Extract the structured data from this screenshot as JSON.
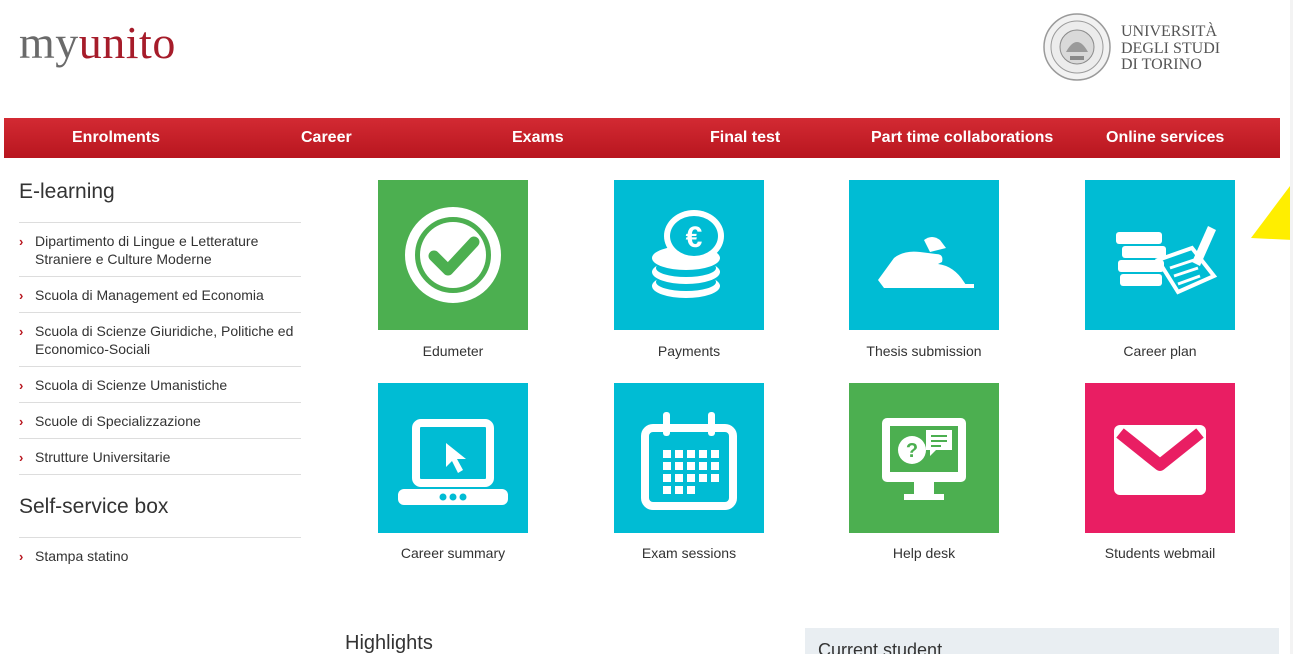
{
  "header": {
    "logo_part1": "my",
    "logo_part2": "unito",
    "university_line1": "UNIVERSITÀ",
    "university_line2": "DEGLI STUDI",
    "university_line3": "DI TORINO",
    "seal_icon": "university-seal-icon",
    "brand_color": "#b8161f"
  },
  "nav": [
    "Enrolments",
    "Career",
    "Exams",
    "Final test",
    "Part time collaborations",
    "Online services"
  ],
  "sidebar": {
    "elearning_title": "E-learning",
    "elearning_items": [
      "Dipartimento di Lingue e Letterature Straniere e Culture Moderne",
      "Scuola di Management ed Economia",
      "Scuola di Scienze Giuridiche, Politiche ed Economico-Sociali",
      "Scuola di Scienze Umanistiche",
      "Scuole di Specializzazione",
      "Strutture Universitarie"
    ],
    "selfservice_title": "Self-service box",
    "selfservice_items": [
      "Stampa statino"
    ]
  },
  "tiles": [
    {
      "label": "Edumeter",
      "icon": "checkmark-icon",
      "color": "#4caf50"
    },
    {
      "label": "Payments",
      "icon": "euro-coins-icon",
      "color": "#00bcd4"
    },
    {
      "label": "Thesis submission",
      "icon": "hand-submit-icon",
      "color": "#00bcd4"
    },
    {
      "label": "Career plan",
      "icon": "books-pen-icon",
      "color": "#00bcd4"
    },
    {
      "label": "Career summary",
      "icon": "laptop-cursor-icon",
      "color": "#00bcd4"
    },
    {
      "label": "Exam sessions",
      "icon": "calendar-icon",
      "color": "#00bcd4"
    },
    {
      "label": "Help desk",
      "icon": "monitor-chat-icon",
      "color": "#4caf50"
    },
    {
      "label": "Students webmail",
      "icon": "envelope-icon",
      "color": "#e91e63"
    }
  ],
  "highlights_title": "Highlights",
  "current_student_title": "Current student",
  "annotation_arrow_color": "#ffee00"
}
